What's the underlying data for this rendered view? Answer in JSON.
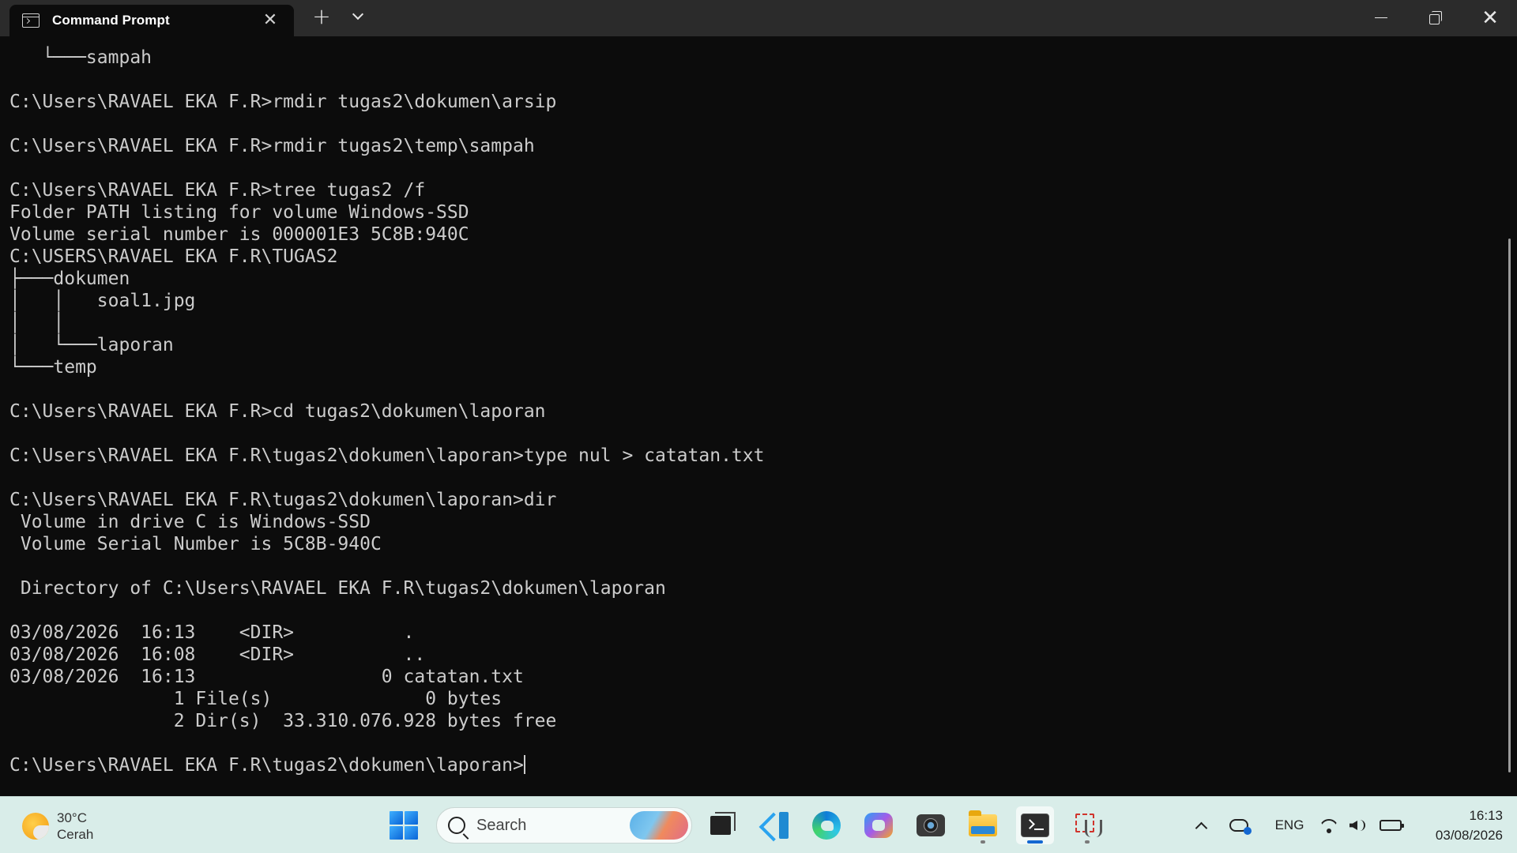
{
  "window": {
    "tab_title": "Command Prompt",
    "icons": {
      "tab": "terminal-tab-icon",
      "close_tab": "close-icon",
      "new_tab": "plus-icon",
      "dropdown": "chevron-down-icon",
      "minimize": "minimize-icon",
      "maximize": "restore-icon",
      "close": "close-icon"
    },
    "close_glyph": "✕",
    "new_tab_glyph": "+"
  },
  "terminal": {
    "lines": [
      "   └───sampah",
      "",
      "C:\\Users\\RAVAEL EKA F.R>rmdir tugas2\\dokumen\\arsip",
      "",
      "C:\\Users\\RAVAEL EKA F.R>rmdir tugas2\\temp\\sampah",
      "",
      "C:\\Users\\RAVAEL EKA F.R>tree tugas2 /f",
      "Folder PATH listing for volume Windows-SSD",
      "Volume serial number is 000001E3 5C8B:940C",
      "C:\\USERS\\RAVAEL EKA F.R\\TUGAS2",
      "├───dokumen",
      "│   │   soal1.jpg",
      "│   │",
      "│   └───laporan",
      "└───temp",
      "",
      "C:\\Users\\RAVAEL EKA F.R>cd tugas2\\dokumen\\laporan",
      "",
      "C:\\Users\\RAVAEL EKA F.R\\tugas2\\dokumen\\laporan>type nul > catatan.txt",
      "",
      "C:\\Users\\RAVAEL EKA F.R\\tugas2\\dokumen\\laporan>dir",
      " Volume in drive C is Windows-SSD",
      " Volume Serial Number is 5C8B-940C",
      "",
      " Directory of C:\\Users\\RAVAEL EKA F.R\\tugas2\\dokumen\\laporan",
      "",
      "03/08/2026  16:13    <DIR>          .",
      "03/08/2026  16:08    <DIR>          ..",
      "03/08/2026  16:13                 0 catatan.txt",
      "               1 File(s)              0 bytes",
      "               2 Dir(s)  33.310.076.928 bytes free",
      ""
    ],
    "prompt": "C:\\Users\\RAVAEL EKA F.R\\tugas2\\dokumen\\laporan>",
    "text_color": "#cccccc",
    "background": "#0c0c0c"
  },
  "taskbar": {
    "weather": {
      "temp": "30°C",
      "condition": "Cerah",
      "icon": "partly-sunny-icon"
    },
    "search_placeholder": "Search",
    "apps": [
      {
        "name": "task-view-icon"
      },
      {
        "name": "vscode-icon"
      },
      {
        "name": "edge-icon"
      },
      {
        "name": "copilot-icon"
      },
      {
        "name": "camera-icon"
      },
      {
        "name": "file-explorer-icon"
      },
      {
        "name": "terminal-icon"
      },
      {
        "name": "snipping-tool-icon"
      }
    ],
    "tray": {
      "language": "ENG",
      "battery_level": 0.85
    },
    "clock": {
      "time": "16:13",
      "date": "03/08/2026"
    },
    "accent": "#1367d1",
    "background": "#d9ede9"
  }
}
